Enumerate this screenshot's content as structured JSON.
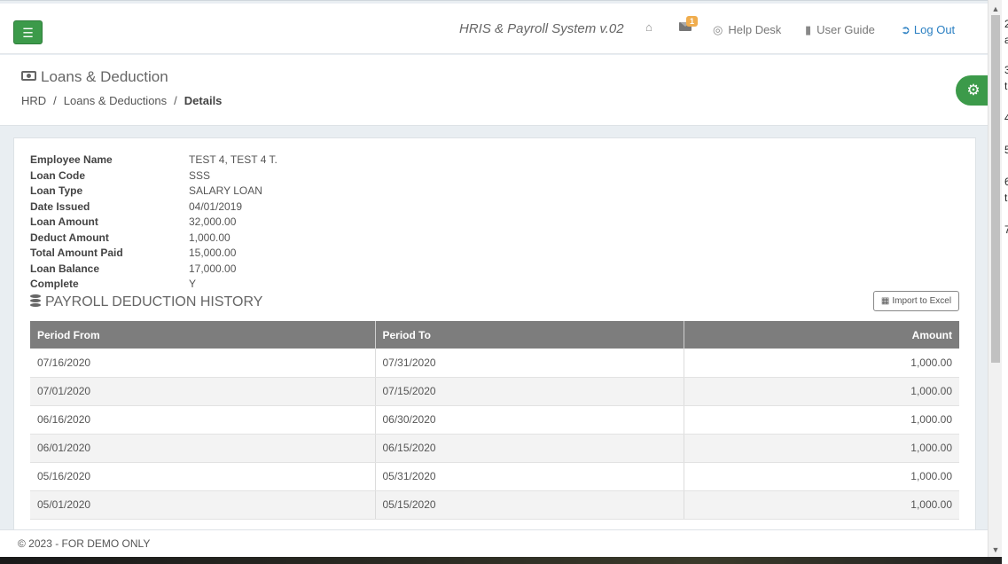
{
  "header": {
    "system_title": "HRIS & Payroll System v.02",
    "mail_badge": "1",
    "help_desk": "Help Desk",
    "user_guide": "User Guide",
    "logout": "Log Out"
  },
  "page": {
    "title": "Loans & Deduction",
    "breadcrumb": [
      "HRD",
      "Loans & Deductions",
      "Details"
    ]
  },
  "details": [
    {
      "label": "Employee Name",
      "value": "TEST 4, TEST 4 T."
    },
    {
      "label": "Loan Code",
      "value": "SSS"
    },
    {
      "label": "Loan Type",
      "value": "SALARY LOAN"
    },
    {
      "label": "Date Issued",
      "value": "04/01/2019"
    },
    {
      "label": "Loan Amount",
      "value": "32,000.00"
    },
    {
      "label": "Deduct Amount",
      "value": "1,000.00"
    },
    {
      "label": "Total Amount Paid",
      "value": "15,000.00"
    },
    {
      "label": "Loan Balance",
      "value": "17,000.00"
    },
    {
      "label": "Complete",
      "value": "Y"
    }
  ],
  "history": {
    "title": "PAYROLL DEDUCTION HISTORY",
    "export_label": "Import to Excel",
    "columns": [
      "Period From",
      "Period To",
      "Amount"
    ],
    "rows": [
      [
        "07/16/2020",
        "07/31/2020",
        "1,000.00"
      ],
      [
        "07/01/2020",
        "07/15/2020",
        "1,000.00"
      ],
      [
        "06/16/2020",
        "06/30/2020",
        "1,000.00"
      ],
      [
        "06/01/2020",
        "06/15/2020",
        "1,000.00"
      ],
      [
        "05/16/2020",
        "05/31/2020",
        "1,000.00"
      ],
      [
        "05/01/2020",
        "05/15/2020",
        "1,000.00"
      ]
    ]
  },
  "footer": {
    "text": "© 2023 - FOR DEMO ONLY"
  },
  "side_pane": [
    "2",
    "a",
    "3",
    "t",
    "4",
    "5",
    "6",
    "t",
    "7"
  ],
  "colors": {
    "accent_green": "#3c9a4a",
    "link_blue": "#2a7fc2",
    "table_header": "#7d7d7d",
    "badge": "#f0ad4e"
  }
}
